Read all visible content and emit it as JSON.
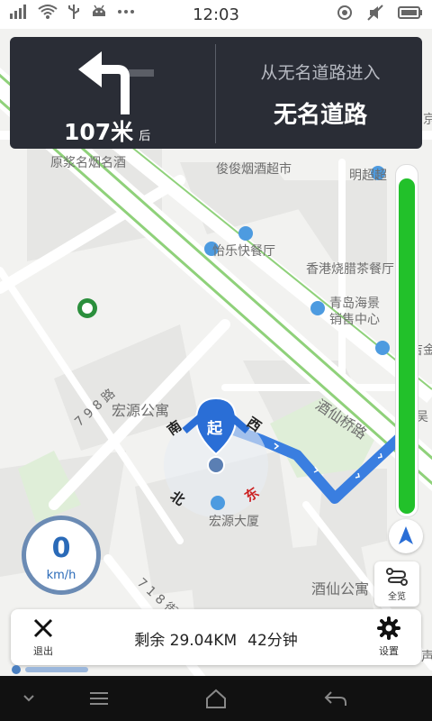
{
  "status_bar": {
    "time": "12:03",
    "icons_left": [
      "signal-icon",
      "wifi-icon",
      "usb-icon",
      "android-icon",
      "more-icon"
    ],
    "icons_right": [
      "location-icon",
      "mute-icon",
      "battery-icon"
    ]
  },
  "navigation": {
    "turn_direction": "left",
    "distance_value": "107米",
    "distance_suffix": "后",
    "from_text": "从无名道路进入",
    "road_name": "无名道路"
  },
  "map": {
    "labels": {
      "poi_0": "原浆名烟名酒",
      "poi_1": "俊俊烟酒超市",
      "poi_2": "明超超",
      "poi_3": "怡乐快餐厅",
      "poi_4": "香港烧腊茶餐厅",
      "poi_5": "青岛海景",
      "poi_6": "销售中心",
      "road_0": "酒仙桥路",
      "road_1": "7 9 8 路",
      "poi_7": "宏源公寓",
      "poi_8": "宏源大厦",
      "road_2": "7 1 8 街",
      "poi_9": "酒仙公寓",
      "poi_10": "吴",
      "poi_11": "吉金",
      "poi_12": "京",
      "poi_13": "声"
    },
    "compass_marks": {
      "north": "南",
      "east": "西",
      "south": "北",
      "west": "东"
    },
    "start_marker": "起",
    "route_color": "#3a7ee0"
  },
  "progress": {
    "remaining_fraction": 0.97,
    "color": "#22c12a"
  },
  "speed": {
    "value": "0",
    "unit": "km/h"
  },
  "buttons": {
    "overview_label": "全览",
    "exit_label": "退出",
    "settings_label": "设置"
  },
  "trip": {
    "remaining_distance": "剩余 29.04KM",
    "remaining_time": "42分钟"
  },
  "system_nav": [
    "chevron-down-icon",
    "menu-icon",
    "home-icon",
    "back-icon"
  ]
}
